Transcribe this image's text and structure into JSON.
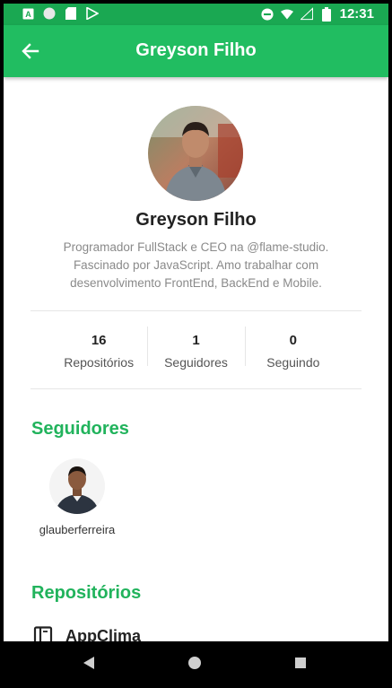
{
  "status_bar": {
    "time": "12:31",
    "left_icons": [
      "a-box-icon",
      "circle-icon",
      "sd-card-icon",
      "play-store-icon"
    ],
    "right_icons": [
      "do-not-disturb-icon",
      "wifi-icon",
      "signal-icon",
      "battery-icon"
    ]
  },
  "app_bar": {
    "title": "Greyson Filho",
    "back_icon": "arrow-left-icon"
  },
  "profile": {
    "name": "Greyson Filho",
    "bio": "Programador FullStack e CEO na @flame-studio. Fascinado por JavaScript. Amo trabalhar com desenvolvimento FrontEnd, BackEnd e Mobile."
  },
  "stats": [
    {
      "value": "16",
      "label": "Repositórios"
    },
    {
      "value": "1",
      "label": "Seguidores"
    },
    {
      "value": "0",
      "label": "Seguindo"
    }
  ],
  "sections": {
    "followers_title": "Seguidores",
    "repos_title": "Repositórios"
  },
  "followers": [
    {
      "username": "glauberferreira"
    }
  ],
  "repos": [
    {
      "name": "AppClima",
      "icon": "book-icon"
    }
  ],
  "colors": {
    "primary": "#21bd61",
    "status_bar": "#1aa852",
    "section_title": "#21b35c"
  },
  "nav_bar": {
    "icons": [
      "back-triangle-icon",
      "home-circle-icon",
      "recents-square-icon"
    ]
  }
}
